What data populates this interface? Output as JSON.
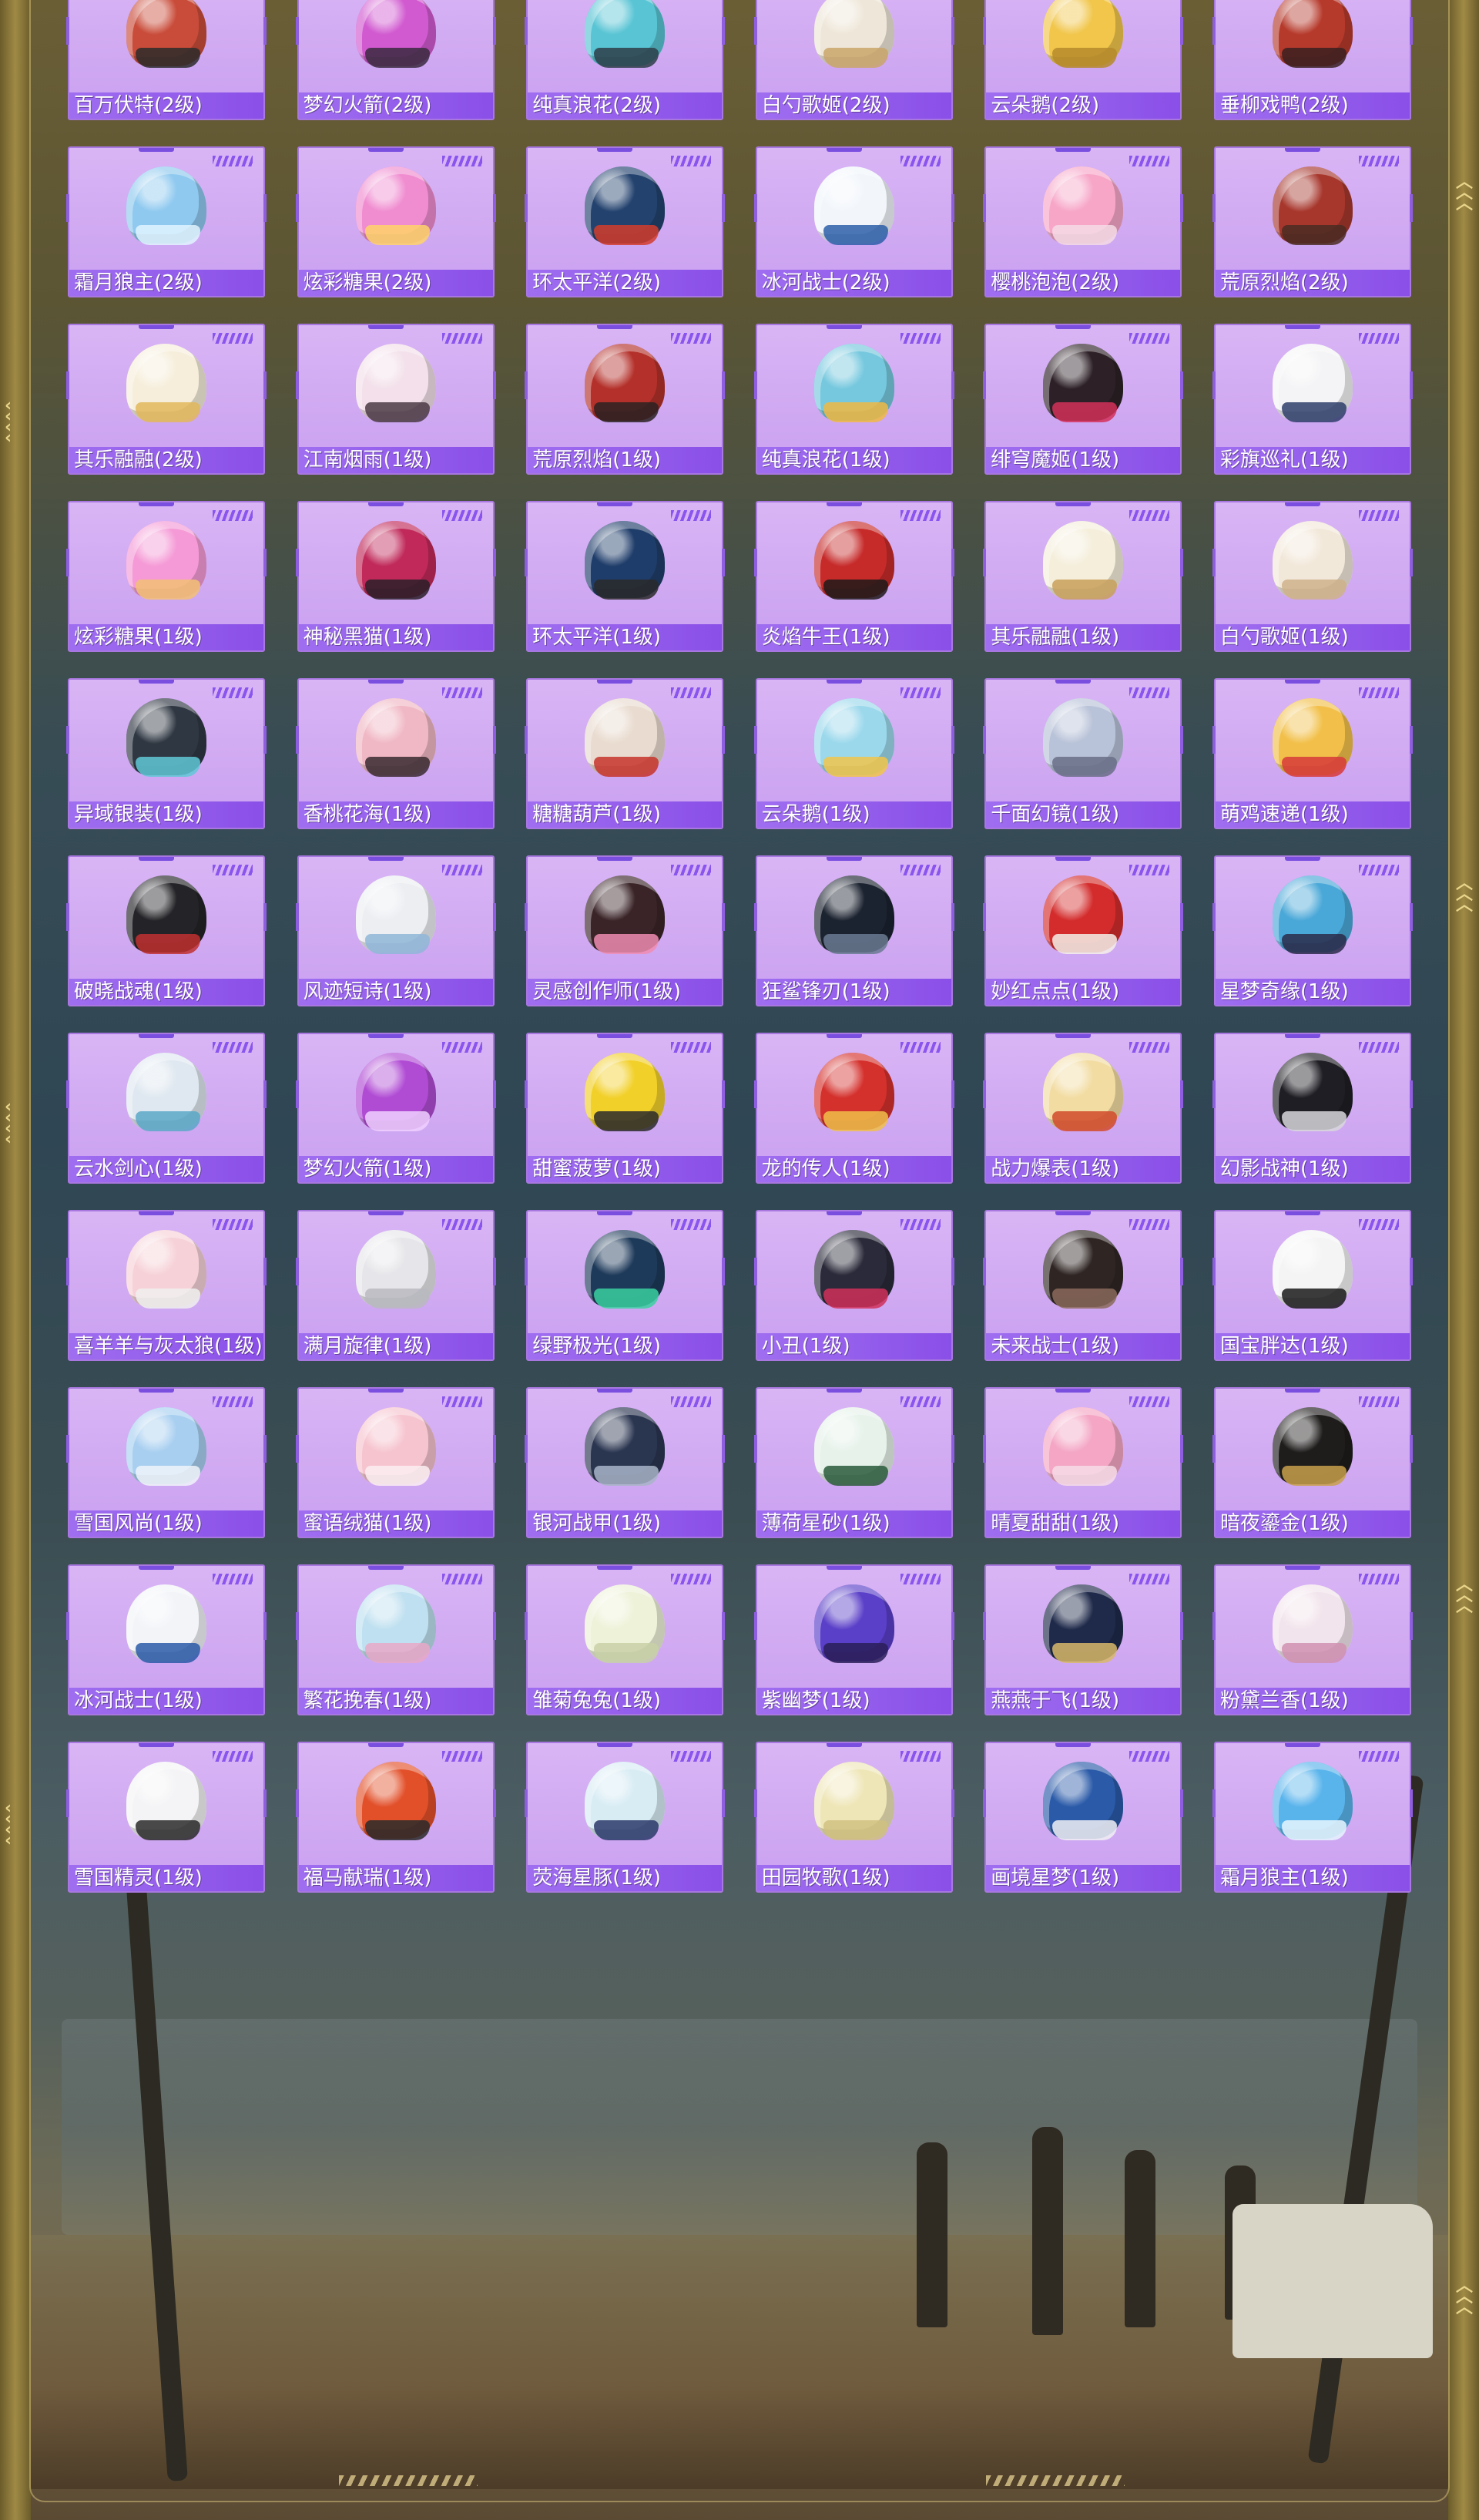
{
  "colors": {
    "card_bg": "#d4acf4",
    "card_border": "#a877df",
    "label_bg": "#9f6ef0",
    "label_text": "#ffffff",
    "frame_gold": "#a08a45"
  },
  "items": [
    {
      "name": "百万伏特(2级)",
      "color": "#c94c3a",
      "accent": "#2b2b2b"
    },
    {
      "name": "梦幻火箭(2级)",
      "color": "#d15ad0",
      "accent": "#3a2a40"
    },
    {
      "name": "纯真浪花(2级)",
      "color": "#58c4d4",
      "accent": "#2e3e48"
    },
    {
      "name": "白勺歌姬(2级)",
      "color": "#eee6d8",
      "accent": "#c9a56a"
    },
    {
      "name": "云朵鹅(2级)",
      "color": "#f1c64b",
      "accent": "#b5892b"
    },
    {
      "name": "垂柳戏鸭(2级)",
      "color": "#b63a2c",
      "accent": "#3a2020"
    },
    {
      "name": "霜月狼主(2级)",
      "color": "#8fc9ef",
      "accent": "#e0f4ff"
    },
    {
      "name": "炫彩糖果(2级)",
      "color": "#f08cd0",
      "accent": "#ffd36a"
    },
    {
      "name": "环太平洋(2级)",
      "color": "#23426e",
      "accent": "#d23c2c"
    },
    {
      "name": "冰河战士(2级)",
      "color": "#f2f6fb",
      "accent": "#2d5fa8"
    },
    {
      "name": "樱桃泡泡(2级)",
      "color": "#f7a6c8",
      "accent": "#f5dbe5"
    },
    {
      "name": "荒原烈焰(2级)",
      "color": "#a7372d",
      "accent": "#4a2b22"
    },
    {
      "name": "其乐融融(2级)",
      "color": "#f6eedb",
      "accent": "#e2b75a"
    },
    {
      "name": "江南烟雨(1级)",
      "color": "#f3e0ea",
      "accent": "#4a3a44"
    },
    {
      "name": "荒原烈焰(1级)",
      "color": "#b4302a",
      "accent": "#2a2222"
    },
    {
      "name": "纯真浪花(1级)",
      "color": "#76c8de",
      "accent": "#f0b843"
    },
    {
      "name": "绯穹魔姬(1级)",
      "color": "#2d2127",
      "accent": "#d4305a"
    },
    {
      "name": "彩旗巡礼(1级)",
      "color": "#f4f4f6",
      "accent": "#2f3e6b"
    },
    {
      "name": "炫彩糖果(1级)",
      "color": "#f59ad6",
      "accent": "#f2c074"
    },
    {
      "name": "神秘黑猫(1级)",
      "color": "#c0295a",
      "accent": "#2a1f28"
    },
    {
      "name": "环太平洋(1级)",
      "color": "#1f3d6a",
      "accent": "#2a2a2a"
    },
    {
      "name": "炎焰牛王(1级)",
      "color": "#c62b2a",
      "accent": "#1f1a1a"
    },
    {
      "name": "其乐融融(1级)",
      "color": "#f4eedb",
      "accent": "#c8a05a"
    },
    {
      "name": "白勺歌姬(1级)",
      "color": "#f2e8da",
      "accent": "#cfb28a"
    },
    {
      "name": "异域银装(1级)",
      "color": "#2f3742",
      "accent": "#5fc8d6"
    },
    {
      "name": "香桃花海(1级)",
      "color": "#f0b7c4",
      "accent": "#3a2a30"
    },
    {
      "name": "糖糖葫芦(1级)",
      "color": "#e9dbcf",
      "accent": "#c6342c"
    },
    {
      "name": "云朵鹅(1级)",
      "color": "#9bd8ec",
      "accent": "#f1c64b"
    },
    {
      "name": "千面幻镜(1级)",
      "color": "#b8c2d8",
      "accent": "#6a6f88"
    },
    {
      "name": "萌鸡速递(1级)",
      "color": "#f2c04a",
      "accent": "#d83a3a"
    },
    {
      "name": "破晓战魂(1级)",
      "color": "#242428",
      "accent": "#c03030"
    },
    {
      "name": "风迹短诗(1级)",
      "color": "#eceef2",
      "accent": "#8fb6d8"
    },
    {
      "name": "灵感创作师(1级)",
      "color": "#3a2428",
      "accent": "#f08cb0"
    },
    {
      "name": "狂鲨锋刃(1级)",
      "color": "#1c2330",
      "accent": "#6a7a92"
    },
    {
      "name": "妙红点点(1级)",
      "color": "#d42c2c",
      "accent": "#f4f0ea"
    },
    {
      "name": "星梦奇缘(1级)",
      "color": "#4aa8d8",
      "accent": "#2a2a4a"
    },
    {
      "name": "云水剑心(1级)",
      "color": "#dfe8f0",
      "accent": "#5aa8c8"
    },
    {
      "name": "梦幻火箭(1级)",
      "color": "#b04bd4",
      "accent": "#f0d0ff"
    },
    {
      "name": "甜蜜菠萝(1级)",
      "color": "#f2d02a",
      "accent": "#2a2a2a"
    },
    {
      "name": "龙的传人(1级)",
      "color": "#d4302c",
      "accent": "#f0c04a"
    },
    {
      "name": "战力爆表(1级)",
      "color": "#f2dca2",
      "accent": "#d24a2a"
    },
    {
      "name": "幻影战神(1级)",
      "color": "#1e1e24",
      "accent": "#d8d8dc"
    },
    {
      "name": "喜羊羊与灰太狼(1级)",
      "color": "#f6d2d8",
      "accent": "#f0f0f0"
    },
    {
      "name": "满月旋律(1级)",
      "color": "#e6e6ea",
      "accent": "#b8b8c0"
    },
    {
      "name": "绿野极光(1级)",
      "color": "#1e3a5a",
      "accent": "#3ad0a0"
    },
    {
      "name": "小丑(1级)",
      "color": "#2a2a3a",
      "accent": "#d0305a"
    },
    {
      "name": "未来战士(1级)",
      "color": "#2f2624",
      "accent": "#8a6a5a"
    },
    {
      "name": "国宝胖达(1级)",
      "color": "#f4f4f4",
      "accent": "#1a1a1a"
    },
    {
      "name": "雪国风尚(1级)",
      "color": "#a8cff0",
      "accent": "#f0f4fa"
    },
    {
      "name": "蜜语绒猫(1级)",
      "color": "#f6c4cf",
      "accent": "#fbeef2"
    },
    {
      "name": "银河战甲(1级)",
      "color": "#2a3550",
      "accent": "#a8b4c8"
    },
    {
      "name": "薄荷星砂(1级)",
      "color": "#e6f2ea",
      "accent": "#2a5a3a"
    },
    {
      "name": "晴夏甜甜(1级)",
      "color": "#f4a6c4",
      "accent": "#f6dce6"
    },
    {
      "name": "暗夜鎏金(1级)",
      "color": "#1f1d1c",
      "accent": "#c8a04a"
    },
    {
      "name": "冰河战士(1级)",
      "color": "#f2f4f8",
      "accent": "#2a5aa8"
    },
    {
      "name": "繁花挽春(1级)",
      "color": "#bfe0f0",
      "accent": "#e8a8c8"
    },
    {
      "name": "雏菊兔兔(1级)",
      "color": "#eef2d8",
      "accent": "#c8d0a8"
    },
    {
      "name": "紫幽梦(1级)",
      "color": "#5a3fc8",
      "accent": "#2a1f58"
    },
    {
      "name": "燕燕于飞(1级)",
      "color": "#1f2a4a",
      "accent": "#d8b86a"
    },
    {
      "name": "粉黛兰香(1级)",
      "color": "#f2e4ec",
      "accent": "#d090b0"
    },
    {
      "name": "雪国精灵(1级)",
      "color": "#f4f4f6",
      "accent": "#2a2a2a"
    },
    {
      "name": "福马献瑞(1级)",
      "color": "#e2502a",
      "accent": "#2a2a2a"
    },
    {
      "name": "荧海星豚(1级)",
      "color": "#d8ecf4",
      "accent": "#2a3a6a"
    },
    {
      "name": "田园牧歌(1级)",
      "color": "#efe6b8",
      "accent": "#d0c080"
    },
    {
      "name": "画境星梦(1级)",
      "color": "#2a5aa8",
      "accent": "#f0f0f4"
    },
    {
      "name": "霜月狼主(1级)",
      "color": "#5ab4ec",
      "accent": "#e8f6ff"
    }
  ]
}
